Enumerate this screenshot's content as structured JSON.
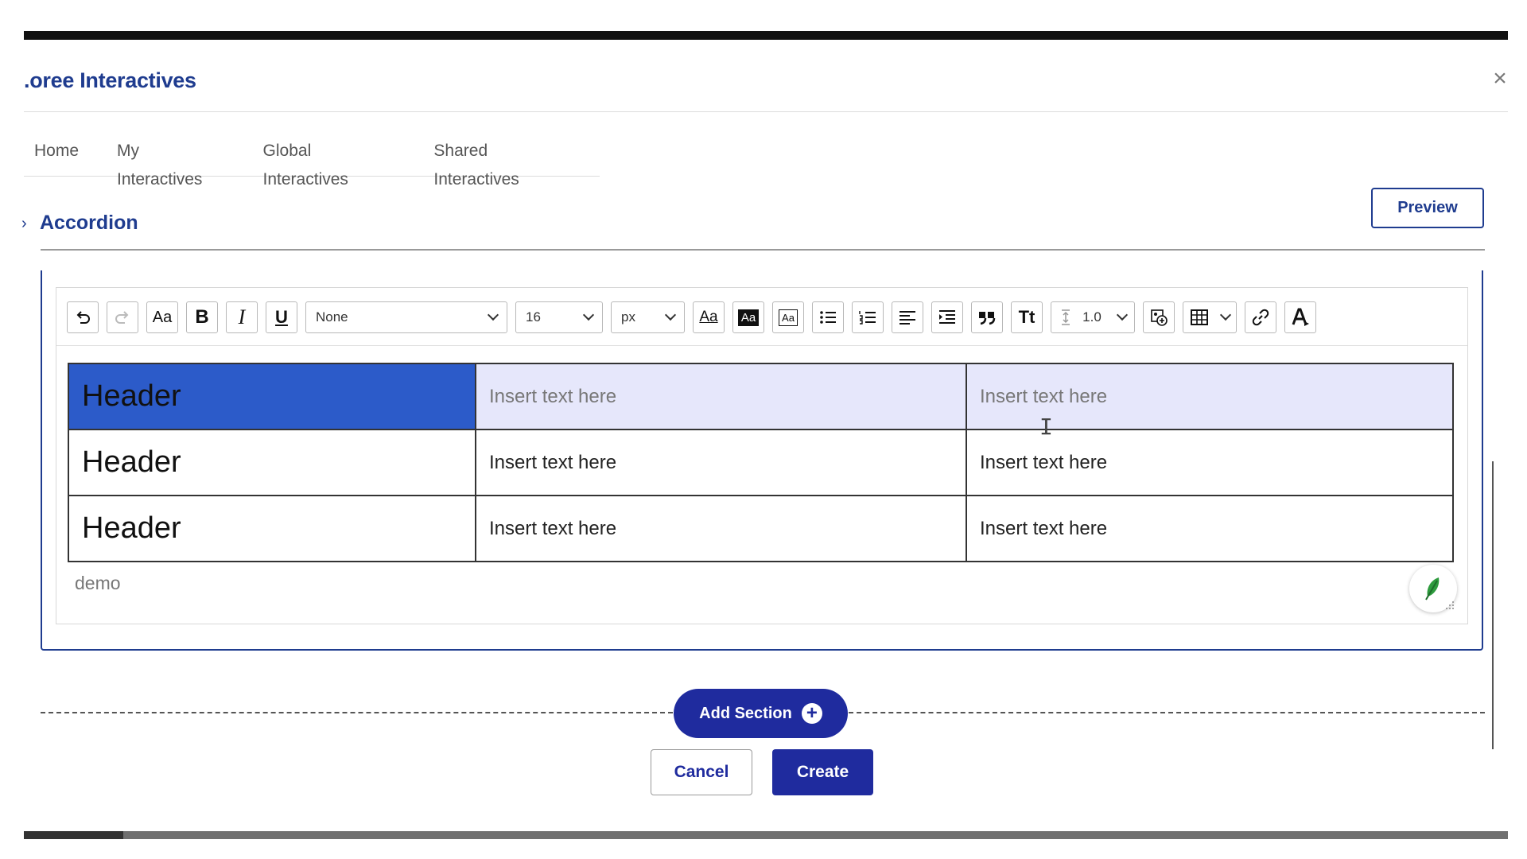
{
  "app": {
    "title": ".oree Interactives",
    "close_symbol": "×"
  },
  "nav": {
    "tabs": [
      {
        "label": "Home"
      },
      {
        "label": "My Interactives"
      },
      {
        "label": "Global Interactives"
      },
      {
        "label": "Shared Interactives"
      }
    ]
  },
  "section": {
    "title": "Accordion",
    "chevron": "›",
    "preview_label": "Preview"
  },
  "toolbar": {
    "undo_icon": "undo-icon",
    "redo_icon": "redo-icon",
    "font_case_label": "Aa",
    "bold_label": "B",
    "italic_label": "I",
    "underline_label": "U",
    "font_family_value": "None",
    "font_size_value": "16",
    "font_unit_value": "px",
    "text_style_label": "Aa",
    "highlight_label": "Aa",
    "box_label": "Aa",
    "heading_label": "Tt",
    "line_height_value": "1.0"
  },
  "table": {
    "rows": [
      {
        "header": "Header",
        "c1": "Insert text here",
        "c2": "Insert text here",
        "selected": true
      },
      {
        "header": "Header",
        "c1": "Insert text here",
        "c2": "Insert text here",
        "selected": false
      },
      {
        "header": "Header",
        "c1": "Insert text here",
        "c2": "Insert text here",
        "selected": false
      }
    ]
  },
  "caption": "demo",
  "actions": {
    "add_section_label": "Add Section",
    "add_icon": "+",
    "cancel_label": "Cancel",
    "create_label": "Create"
  },
  "colors": {
    "brand": "#1f3c8f",
    "primary_button": "#1f2b9e",
    "selected_header": "#2c5bc9",
    "selected_row": "#e6e7fb",
    "feather": "#2e9b3e"
  }
}
